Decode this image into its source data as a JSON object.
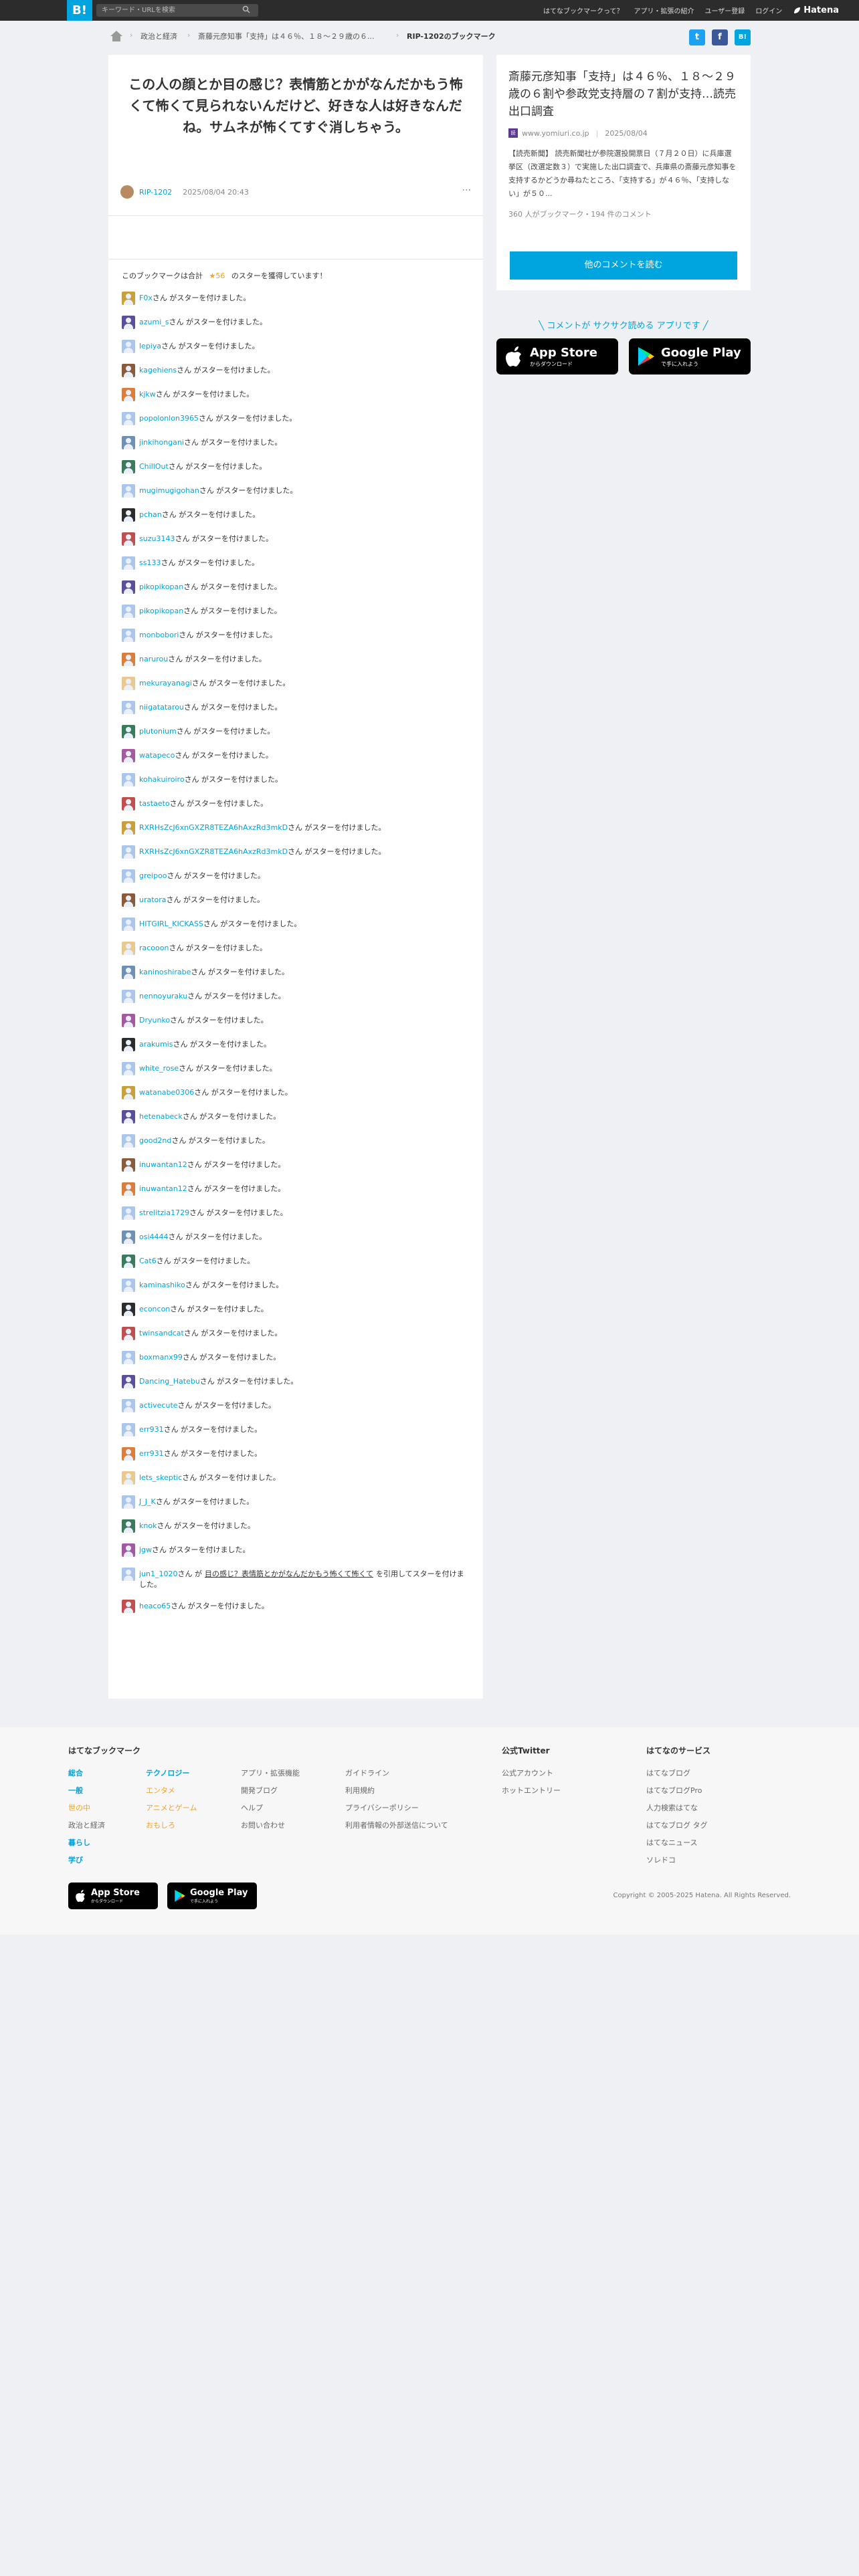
{
  "topbar": {
    "logo": "B!",
    "search_placeholder": "キーワード・URLを検索",
    "nav": [
      "はてなブックマークって？",
      "アプリ・拡張の紹介",
      "ユーザー登録",
      "ログイン"
    ],
    "brand": "Hatena"
  },
  "breadcrumb": [
    "政治と経済",
    "斎藤元彦知事「支持」は４６％、１８～２９歳の６...",
    "RIP-1202のブックマーク"
  ],
  "share": {
    "twitter": "t",
    "facebook": "f",
    "hatena": "B!"
  },
  "comment": {
    "text": "この人の顔とか目の感じ？表情筋とかがなんだかもう怖くて怖くて見られないんだけど、好きな人は好きなんだね。サムネが怖くてすぐ消しちゃう。",
    "author": "RIP-1202",
    "date": "2025/08/04 20:43",
    "more": "···"
  },
  "stars": {
    "summary_prefix": "このブックマークは合計",
    "count": "★56",
    "summary_suffix": "のスターを獲得しています！",
    "suffix": "さん がスターを付けました。",
    "quote_suffix": "さん が",
    "quote_text": "目の感じ？表情筋とかがなんだかもう怖くて怖くて",
    "quote_tail": "を引用してスターを付けました。",
    "users": [
      "F0x",
      "azumi_s",
      "lepiya",
      "kagehiens",
      "kjkw",
      "popolonlon3965",
      "jinkihongani",
      "ChillOut",
      "mugimugigohan",
      "pchan",
      "suzu3143",
      "ss133",
      "pikopikopan",
      "pikopikopan",
      "monbobori",
      "narurou",
      "mekurayanagi",
      "niigatatarou",
      "plutonium",
      "watapeco",
      "kohakuiroiro",
      "tastaeto",
      "RXRHsZcJ6xnGXZR8TEZA6hAxzRd3mkD",
      "RXRHsZcJ6xnGXZR8TEZA6hAxzRd3mkD",
      "greipoo",
      "uratora",
      "HITGIRL_KICKASS",
      "racooon",
      "kaninoshirabe",
      "nennoyuraku",
      "Dryunko",
      "arakumis",
      "white_rose",
      "watanabe0306",
      "hetenabeck",
      "good2nd",
      "inuwantan12",
      "inuwantan12",
      "strelitzia1729",
      "osi4444",
      "Cat6",
      "kaminashiko",
      "econcon",
      "twinsandcat",
      "boxmanx99",
      "Dancing_Hatebu",
      "activecute",
      "err931",
      "err931",
      "lets_skeptic",
      "J_J_K",
      "knok",
      "jgw",
      "jun1_1020",
      "heaco65"
    ]
  },
  "news": {
    "title": "斎藤元彦知事「支持」は４６％、１８～２９歳の６割や参政党支持層の７割が支持…読売出口調査",
    "source": "www.yomiuri.co.jp",
    "source_icon": "読",
    "date": "2025/08/04",
    "description": "【読売新聞】 読売新聞社が参院選投開票日（７月２０日）に兵庫選挙区（改選定数３）で実施した出口調査で、兵庫県の斎藤元彦知事を支持するかどうか尋ねたところ、「支持する」が４６％、「支持しない」が５０...",
    "stats": "360 人がブックマーク・194 件のコメント",
    "others_button": "他のコメントを読む"
  },
  "app": {
    "tagline": "╲ コメントが サクサク読める アプリです ╱",
    "appstore_sub": "からダウンロード",
    "appstore": "App Store",
    "googleplay_sub": "で手に入れよう",
    "googleplay": "Google Play"
  },
  "footer": {
    "heading": "はてなブックマーク",
    "col1": [
      "総合",
      "一般",
      "世の中",
      "政治と経済",
      "暮らし",
      "学び"
    ],
    "col2": [
      "テクノロジー",
      "エンタメ",
      "アニメとゲーム",
      "おもしろ"
    ],
    "col3": [
      "アプリ・拡張機能",
      "開発ブログ",
      "ヘルプ",
      "お問い合わせ"
    ],
    "col4": [
      "ガイドライン",
      "利用規約",
      "プライバシーポリシー",
      "利用者情報の外部送信について"
    ],
    "twitter_title": "公式Twitter",
    "twitter_links": [
      "公式アカウント",
      "ホットエントリー"
    ],
    "services_title": "はてなのサービス",
    "services": [
      "はてなブログ",
      "はてなブログPro",
      "人力検索はてな",
      "はてなブログ タグ",
      "はてなニュース",
      "ソレドコ"
    ],
    "copyright": "Copyright © 2005-2025 Hatena. All Rights Reserved."
  },
  "colors": {
    "accent": "#00a4de",
    "topbar": "#2c2c2c",
    "star": "#f4a024"
  }
}
